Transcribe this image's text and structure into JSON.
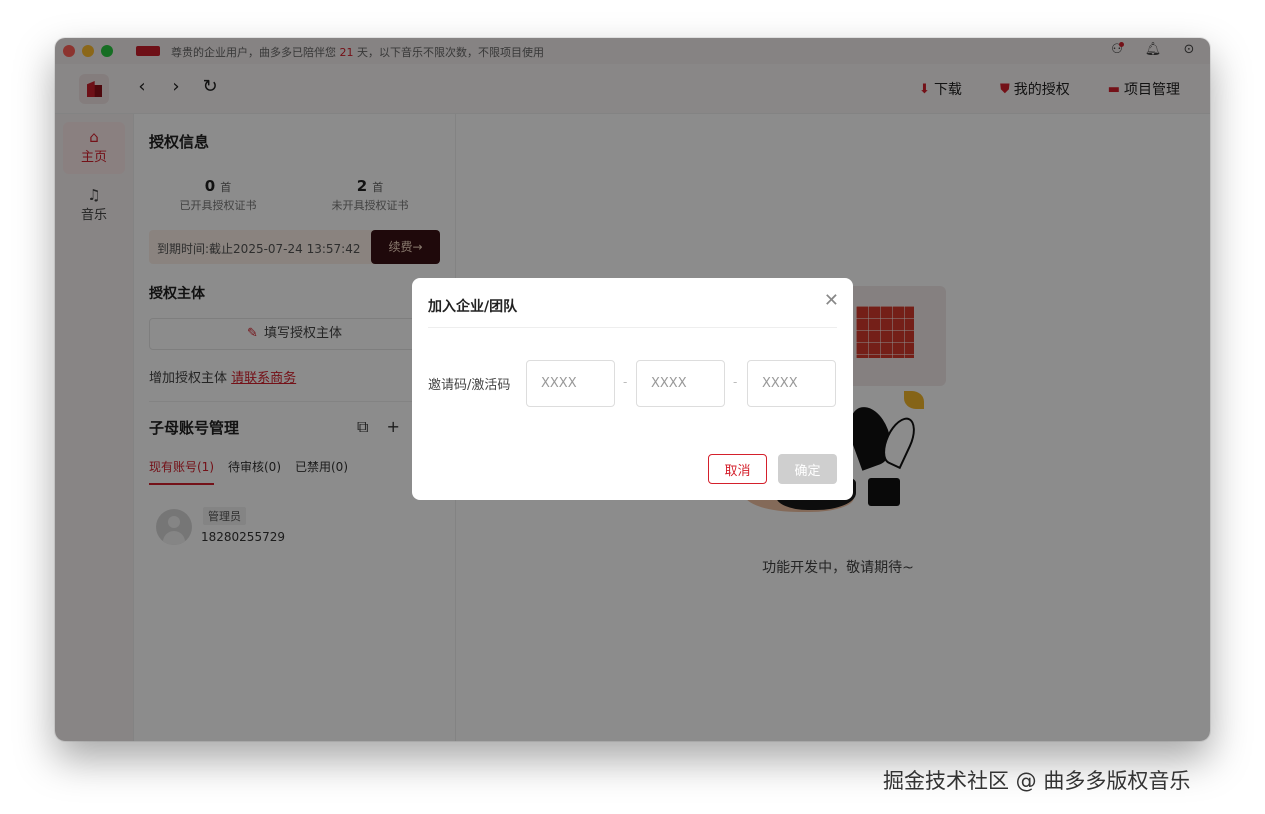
{
  "titlebar": {
    "notice_prefix": "尊贵的企业用户，曲多多已陪伴您",
    "notice_days": "21",
    "notice_suffix": "天，以下音乐不限次数，不限项目使用",
    "icons": [
      "user-icon",
      "bell-icon",
      "settings-icon"
    ]
  },
  "toolbar": {
    "nav": {
      "back": "‹",
      "forward": "›",
      "refresh": "↻"
    },
    "actions": [
      {
        "label": "下载",
        "icon": "download-icon"
      },
      {
        "label": "我的授权",
        "icon": "shield-icon"
      },
      {
        "label": "项目管理",
        "icon": "folder-icon"
      }
    ]
  },
  "rail": {
    "items": [
      {
        "label": "主页",
        "icon": "home-icon",
        "active": true
      },
      {
        "label": "音乐",
        "icon": "music-icon",
        "active": false
      }
    ]
  },
  "auth_info": {
    "title": "授权信息",
    "unit": "首",
    "opened": {
      "count": "0",
      "label": "已开具授权证书"
    },
    "unopened": {
      "count": "2",
      "label": "未开具授权证书"
    },
    "expire_text": "到期时间:截止2025-07-24 13:57:42",
    "renew_label": "续费→"
  },
  "auth_subject": {
    "title": "授权主体",
    "fill_label": "填写授权主体",
    "add_text": "增加授权主体",
    "contact_link": "请联系商务"
  },
  "accounts": {
    "title": "子母账号管理",
    "tabs": [
      {
        "label": "现有账号(1)",
        "active": true
      },
      {
        "label": "待审核(0)",
        "active": false
      },
      {
        "label": "已禁用(0)",
        "active": false
      }
    ],
    "members": [
      {
        "role": "管理员",
        "phone": "18280255729"
      }
    ]
  },
  "main": {
    "placeholder_text": "功能开发中，敬请期待~"
  },
  "modal": {
    "title": "加入企业/团队",
    "code_label": "邀请码/激活码",
    "inputs": [
      {
        "placeholder": "XXXX",
        "value": ""
      },
      {
        "placeholder": "XXXX",
        "value": ""
      },
      {
        "placeholder": "XXXX",
        "value": ""
      }
    ],
    "separator": "-",
    "cancel_label": "取消",
    "ok_label": "确定"
  },
  "watermark": "掘金技术社区 @ 曲多多版权音乐",
  "colors": {
    "accent": "#d4202c",
    "renew_bg": "#3a1214"
  }
}
